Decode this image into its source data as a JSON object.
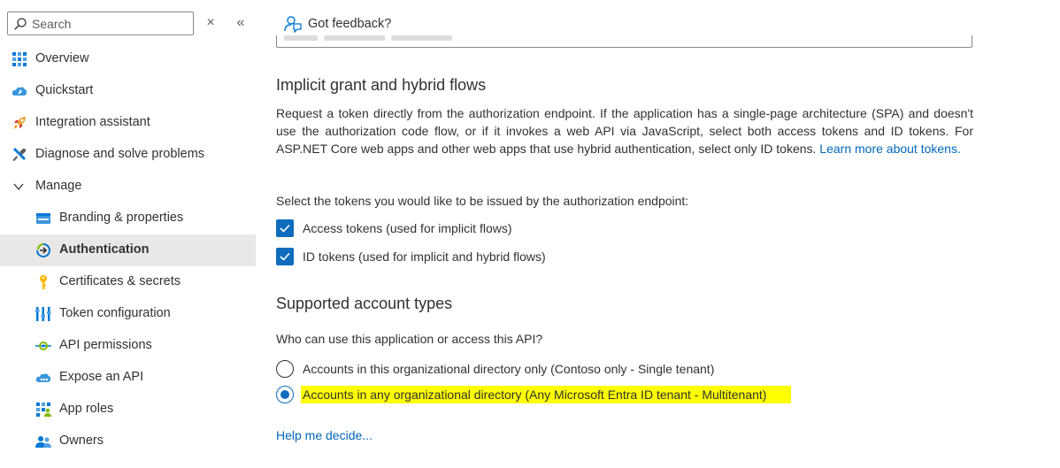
{
  "sidebar": {
    "search": {
      "placeholder": "Search"
    },
    "close_symbol": "×",
    "collapse_symbol": "«",
    "items": [
      {
        "label": "Overview",
        "icon": "overview-icon"
      },
      {
        "label": "Quickstart",
        "icon": "quickstart-icon"
      },
      {
        "label": "Integration assistant",
        "icon": "rocket-icon"
      },
      {
        "label": "Diagnose and solve problems",
        "icon": "wrench-icon"
      },
      {
        "label": "Manage",
        "icon": "chevron-down-icon"
      },
      {
        "label": "Branding & properties",
        "icon": "branding-icon"
      },
      {
        "label": "Authentication",
        "icon": "authentication-icon"
      },
      {
        "label": "Certificates & secrets",
        "icon": "key-icon"
      },
      {
        "label": "Token configuration",
        "icon": "token-icon"
      },
      {
        "label": "API permissions",
        "icon": "api-permissions-icon"
      },
      {
        "label": "Expose an API",
        "icon": "cloud-icon"
      },
      {
        "label": "App roles",
        "icon": "app-roles-icon"
      },
      {
        "label": "Owners",
        "icon": "owners-icon"
      }
    ]
  },
  "header": {
    "feedback_label": "Got feedback?"
  },
  "implicit": {
    "title": "Implicit grant and hybrid flows",
    "description": "Request a token directly from the authorization endpoint. If the application has a single-page architecture (SPA) and doesn't use the authorization code flow, or if it invokes a web API via JavaScript, select both access tokens and ID tokens. For ASP.NET Core web apps and other web apps that use hybrid authentication, select only ID tokens.",
    "learn_more": "Learn more about tokens.",
    "select_label": "Select the tokens you would like to be issued by the authorization endpoint:",
    "access_tokens": "Access tokens (used for implicit flows)",
    "id_tokens": "ID tokens (used for implicit and hybrid flows)"
  },
  "accounts": {
    "title": "Supported account types",
    "question": "Who can use this application or access this API?",
    "option_single": "Accounts in this organizational directory only (Contoso only - Single tenant)",
    "option_multi": "Accounts in any organizational directory (Any Microsoft Entra ID tenant - Multitenant)",
    "help": "Help me decide..."
  },
  "colors": {
    "accent": "#0f6cbd",
    "link": "#0067b8",
    "highlight": "#ffff00",
    "selected_bg": "#e9e8e6"
  }
}
